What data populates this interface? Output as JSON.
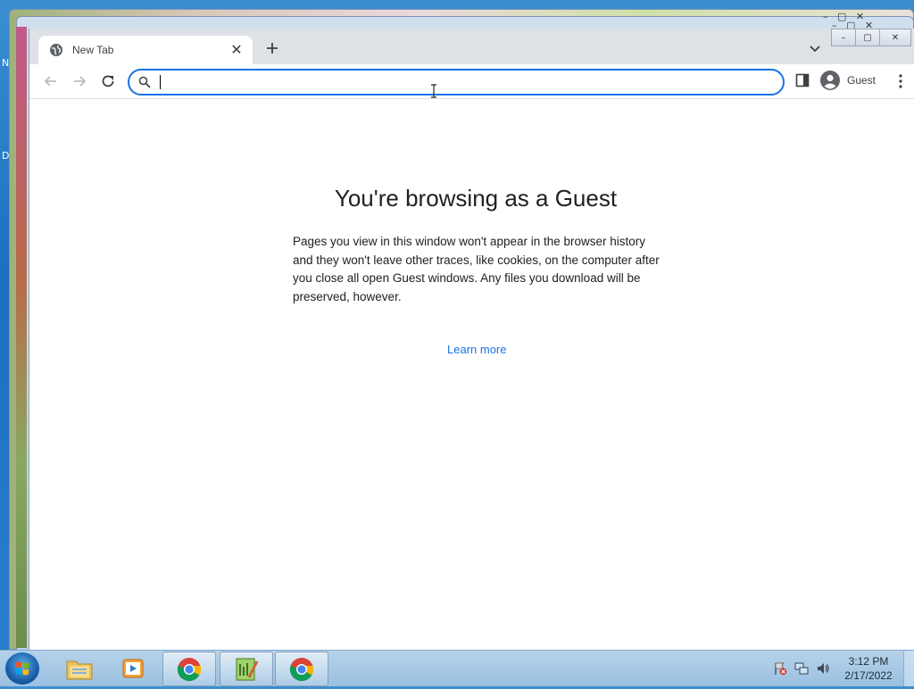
{
  "desktop": {
    "label_1": "N",
    "label_2": "D"
  },
  "browser": {
    "tab": {
      "title": "New Tab"
    },
    "omnibox": {
      "value": "",
      "placeholder": ""
    },
    "profile": {
      "label": "Guest"
    }
  },
  "page": {
    "heading": "You're browsing as a Guest",
    "body": "Pages you view in this window won't appear in the browser history and they won't leave other traces, like cookies, on the computer after you close all open Guest windows. Any files you download will be preserved, however.",
    "link": "Learn more"
  },
  "taskbar": {
    "clock_time": "3:12 PM",
    "clock_date": "2/17/2022",
    "apps": [
      "file-explorer",
      "media-player",
      "chrome",
      "notepad-plus-plus",
      "chrome"
    ]
  },
  "colors": {
    "accent": "#1a73e8",
    "tabstrip": "#dee1e6",
    "heading": "#202124"
  }
}
